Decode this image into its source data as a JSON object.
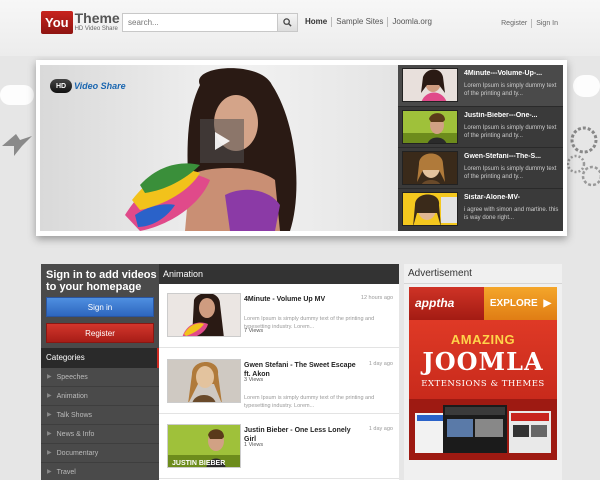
{
  "header": {
    "logo_you": "You",
    "logo_theme": "Theme",
    "logo_sub": "HD Video Share",
    "search_placeholder": "search...",
    "nav": [
      "Home",
      "Sample Sites",
      "Joomla.org"
    ],
    "user_links": [
      "Register",
      "Sign In"
    ]
  },
  "slider": {
    "brand_badge": "HD",
    "brand_text": "Video Share",
    "items": [
      {
        "title": "4Minute---Volume-Up-...",
        "desc": "Lorem Ipsum is simply dummy text of the printing and ty..."
      },
      {
        "title": "Justin-Bieber---One-...",
        "desc": "Lorem Ipsum is simply dummy text of the printing and ty..."
      },
      {
        "title": "Gwen-Stefani---The-S...",
        "desc": "Lorem Ipsum is simply dummy text of the printing and ty..."
      },
      {
        "title": "Sistar-Alone-MV-",
        "desc": "i agree with simon and martine. this is way done right..."
      }
    ]
  },
  "sidebar": {
    "signin_title": "Sign in to add videos to your homepage",
    "signin_btn": "Sign in",
    "register_btn": "Register",
    "categories_heading": "Categories",
    "categories": [
      "Speeches",
      "Animation",
      "Talk Shows",
      "News & Info",
      "Documentary",
      "Travel"
    ]
  },
  "content": {
    "heading": "Animation",
    "videos": [
      {
        "title": "4Minute - Volume Up MV",
        "age": "12 hours ago",
        "desc": "Lorem Ipsum is simply dummy text of the printing and typesetting industry. Lorem...",
        "views": "7 Views"
      },
      {
        "title": "Gwen Stefani - The Sweet Escape ft. Akon",
        "age": "1 day ago",
        "desc": "Lorem Ipsum is simply dummy text of the printing and typesetting industry. Lorem...",
        "views": "3 Views"
      },
      {
        "title": "Justin Bieber - One Less Lonely Girl",
        "age": "1 day ago",
        "desc": "",
        "views": "1 Views"
      }
    ]
  },
  "advertisement": {
    "heading": "Advertisement",
    "brand": "apptha",
    "explore": "EXPLORE",
    "amazing": "AMAZING",
    "joomla": "JOOMLA",
    "extensions": "EXTENSIONS & THEMES",
    "thumb_caption": "JUSTIN BIEBER"
  },
  "colors": {
    "accent_red": "#c8241e",
    "signin_blue": "#2d66bf",
    "dark_panel": "#3a3a3a",
    "ad_orange": "#e07d14"
  }
}
